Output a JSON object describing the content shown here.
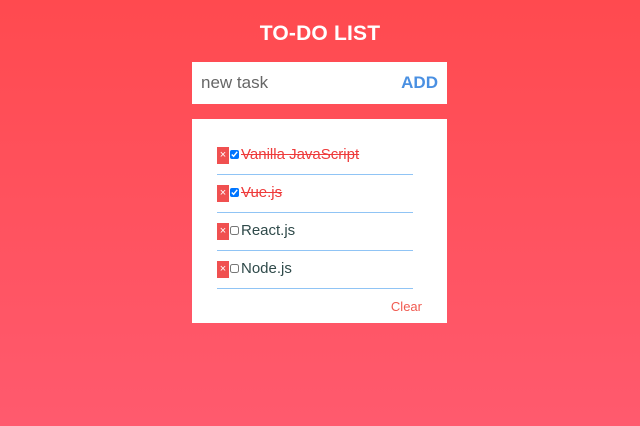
{
  "header": {
    "title": "TO-DO LIST"
  },
  "add_bar": {
    "placeholder": "new task",
    "add_label": "ADD"
  },
  "tasks": [
    {
      "label": "Vanilla JavaScript",
      "done": true
    },
    {
      "label": "Vue.js",
      "done": true
    },
    {
      "label": "React.js",
      "done": false
    },
    {
      "label": "Node.js",
      "done": false
    }
  ],
  "delete_glyph": "×",
  "footer": {
    "clear_label": "Clear"
  },
  "colors": {
    "background_top": "#ff4a4f",
    "background_bottom": "#ff5a6e",
    "accent": "#4a90e2",
    "delete": "#f05050",
    "done_text": "#ee3b3b"
  }
}
